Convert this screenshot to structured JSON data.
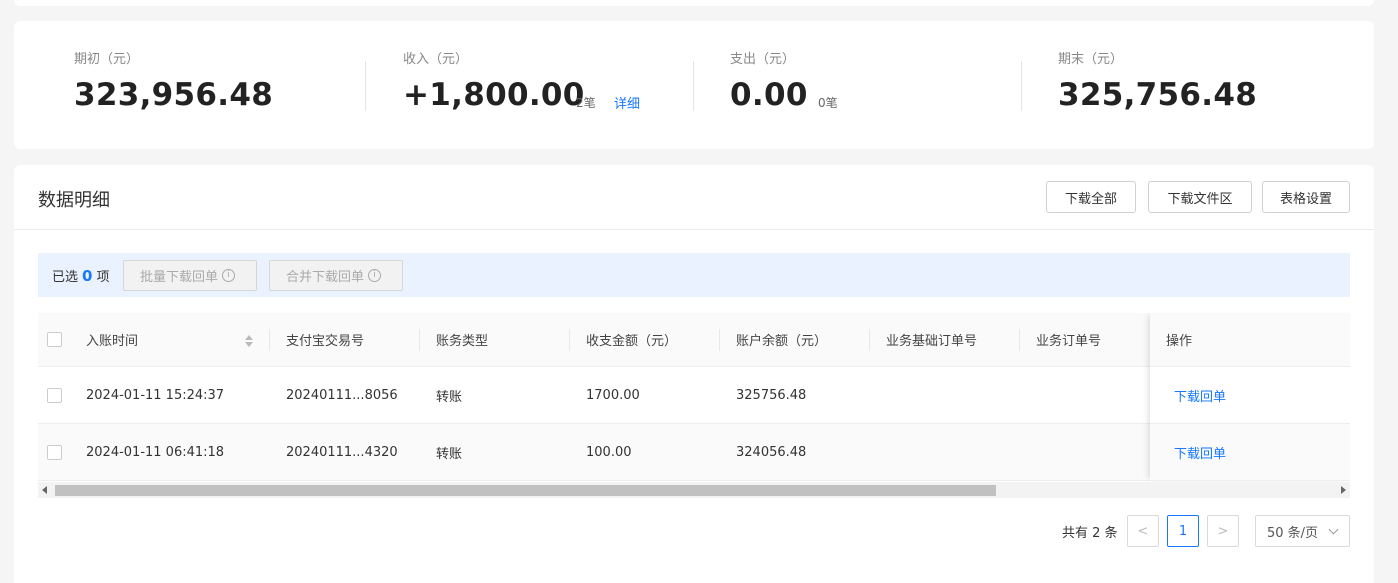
{
  "summary": {
    "opening": {
      "label": "期初（元）",
      "value": "323,956.48"
    },
    "income": {
      "label": "收入（元）",
      "value": "+1,800.00",
      "count": "2笔",
      "detail": "详细"
    },
    "expense": {
      "label": "支出（元）",
      "value": "0.00",
      "count": "0笔"
    },
    "closing": {
      "label": "期末（元）",
      "value": "325,756.48"
    }
  },
  "details": {
    "title": "数据明细",
    "buttons": {
      "download_all": "下载全部",
      "download_files": "下载文件区",
      "table_settings": "表格设置"
    }
  },
  "selection": {
    "prefix": "已选",
    "count": "0",
    "suffix": "项",
    "batch_download": "批量下载回单",
    "merge_download": "合并下载回单"
  },
  "table": {
    "columns": [
      "入账时间",
      "支付宝交易号",
      "账务类型",
      "收支金额（元）",
      "账户余额（元）",
      "业务基础订单号",
      "业务订单号",
      "操作"
    ],
    "rows": [
      {
        "time": "2024-01-11 15:24:37",
        "trade_no": "20240111...8056",
        "type": "转账",
        "amount": "1700.00",
        "balance": "325756.48",
        "base_order": "",
        "order": "",
        "action": "下载回单"
      },
      {
        "time": "2024-01-11 06:41:18",
        "trade_no": "20240111...4320",
        "type": "转账",
        "amount": "100.00",
        "balance": "324056.48",
        "base_order": "",
        "order": "",
        "action": "下载回单"
      }
    ]
  },
  "pagination": {
    "total": "共有 2 条",
    "current_page": "1",
    "page_size": "50 条/页",
    "prev": "<",
    "next": ">"
  }
}
